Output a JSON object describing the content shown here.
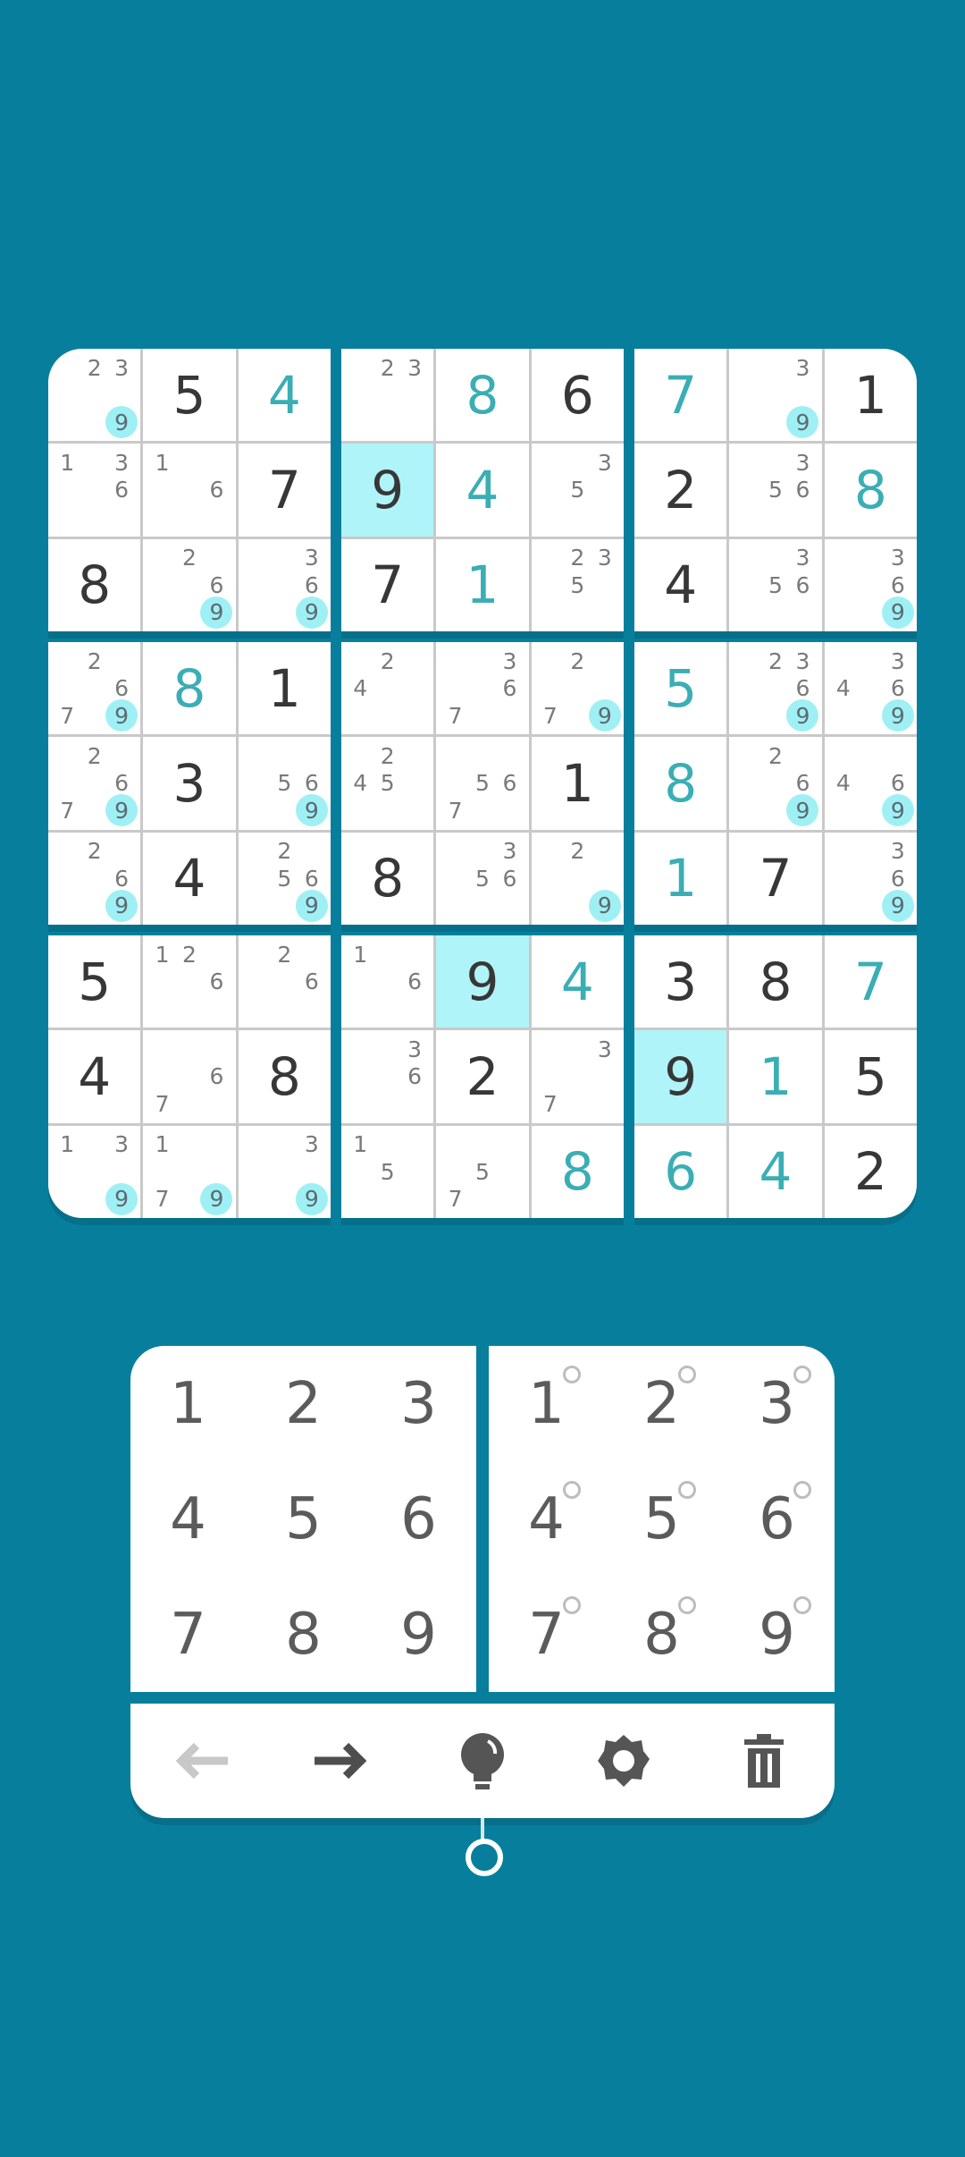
{
  "colors": {
    "background": "#077f9c",
    "highlight": "#aef4f8",
    "user_value": "#3aaeb4",
    "given_value": "#373737"
  },
  "board": [
    [
      {
        "v": "",
        "n": [
          "2",
          "3"
        ],
        "m": [
          "9"
        ]
      },
      {
        "v": "5",
        "t": "g"
      },
      {
        "v": "4",
        "t": "u"
      },
      {
        "v": "",
        "n": [
          "2",
          "3"
        ]
      },
      {
        "v": "8",
        "t": "u"
      },
      {
        "v": "6",
        "t": "g"
      },
      {
        "v": "7",
        "t": "u"
      },
      {
        "v": "",
        "n": [
          "3"
        ],
        "m": [
          "9"
        ]
      },
      {
        "v": "1",
        "t": "g"
      }
    ],
    [
      {
        "v": "",
        "n": [
          "1",
          "3",
          "6"
        ]
      },
      {
        "v": "",
        "n": [
          "1",
          "6"
        ]
      },
      {
        "v": "7",
        "t": "g"
      },
      {
        "v": "9",
        "t": "g",
        "h": true
      },
      {
        "v": "4",
        "t": "u"
      },
      {
        "v": "",
        "n": [
          "3",
          "5"
        ]
      },
      {
        "v": "2",
        "t": "g"
      },
      {
        "v": "",
        "n": [
          "3",
          "5",
          "6"
        ]
      },
      {
        "v": "8",
        "t": "u"
      }
    ],
    [
      {
        "v": "8",
        "t": "g"
      },
      {
        "v": "",
        "n": [
          "2",
          "6"
        ],
        "m": [
          "9"
        ]
      },
      {
        "v": "",
        "n": [
          "3",
          "6"
        ],
        "m": [
          "9"
        ]
      },
      {
        "v": "7",
        "t": "g"
      },
      {
        "v": "1",
        "t": "u"
      },
      {
        "v": "",
        "n": [
          "2",
          "3",
          "5"
        ]
      },
      {
        "v": "4",
        "t": "g"
      },
      {
        "v": "",
        "n": [
          "3",
          "5",
          "6"
        ]
      },
      {
        "v": "",
        "n": [
          "3",
          "6"
        ],
        "m": [
          "9"
        ]
      }
    ],
    [
      {
        "v": "",
        "n": [
          "2",
          "6",
          "7"
        ],
        "m": [
          "9"
        ]
      },
      {
        "v": "8",
        "t": "u"
      },
      {
        "v": "1",
        "t": "g"
      },
      {
        "v": "",
        "n": [
          "2",
          "4"
        ]
      },
      {
        "v": "",
        "n": [
          "3",
          "6",
          "7"
        ]
      },
      {
        "v": "",
        "n": [
          "2",
          "7"
        ],
        "m": [
          "9"
        ]
      },
      {
        "v": "5",
        "t": "u"
      },
      {
        "v": "",
        "n": [
          "2",
          "3",
          "6"
        ],
        "m": [
          "9"
        ]
      },
      {
        "v": "",
        "n": [
          "3",
          "4",
          "6"
        ],
        "m": [
          "9"
        ]
      }
    ],
    [
      {
        "v": "",
        "n": [
          "2",
          "6",
          "7"
        ],
        "m": [
          "9"
        ]
      },
      {
        "v": "3",
        "t": "g"
      },
      {
        "v": "",
        "n": [
          "5",
          "6"
        ],
        "m": [
          "9"
        ]
      },
      {
        "v": "",
        "n": [
          "2",
          "4",
          "5"
        ]
      },
      {
        "v": "",
        "n": [
          "5",
          "6",
          "7"
        ]
      },
      {
        "v": "1",
        "t": "g"
      },
      {
        "v": "8",
        "t": "u"
      },
      {
        "v": "",
        "n": [
          "2",
          "6"
        ],
        "m": [
          "9"
        ]
      },
      {
        "v": "",
        "n": [
          "4",
          "6"
        ],
        "m": [
          "9"
        ]
      }
    ],
    [
      {
        "v": "",
        "n": [
          "2",
          "6"
        ],
        "m": [
          "9"
        ]
      },
      {
        "v": "4",
        "t": "g"
      },
      {
        "v": "",
        "n": [
          "2",
          "5",
          "6"
        ],
        "m": [
          "9"
        ]
      },
      {
        "v": "8",
        "t": "g"
      },
      {
        "v": "",
        "n": [
          "3",
          "5",
          "6"
        ]
      },
      {
        "v": "",
        "n": [
          "2"
        ],
        "m": [
          "9"
        ]
      },
      {
        "v": "1",
        "t": "u"
      },
      {
        "v": "7",
        "t": "g"
      },
      {
        "v": "",
        "n": [
          "3",
          "6"
        ],
        "m": [
          "9"
        ]
      }
    ],
    [
      {
        "v": "5",
        "t": "g"
      },
      {
        "v": "",
        "n": [
          "1",
          "2",
          "6"
        ]
      },
      {
        "v": "",
        "n": [
          "2",
          "6"
        ]
      },
      {
        "v": "",
        "n": [
          "1",
          "6"
        ]
      },
      {
        "v": "9",
        "t": "g",
        "h": true
      },
      {
        "v": "4",
        "t": "u"
      },
      {
        "v": "3",
        "t": "g"
      },
      {
        "v": "8",
        "t": "g"
      },
      {
        "v": "7",
        "t": "u"
      }
    ],
    [
      {
        "v": "4",
        "t": "g"
      },
      {
        "v": "",
        "n": [
          "6",
          "7"
        ]
      },
      {
        "v": "8",
        "t": "g"
      },
      {
        "v": "",
        "n": [
          "3",
          "6"
        ]
      },
      {
        "v": "2",
        "t": "g"
      },
      {
        "v": "",
        "n": [
          "3",
          "7"
        ]
      },
      {
        "v": "9",
        "t": "g",
        "h": true
      },
      {
        "v": "1",
        "t": "u"
      },
      {
        "v": "5",
        "t": "g"
      }
    ],
    [
      {
        "v": "",
        "n": [
          "1",
          "3"
        ],
        "m": [
          "9"
        ]
      },
      {
        "v": "",
        "n": [
          "1",
          "7"
        ],
        "m": [
          "9"
        ]
      },
      {
        "v": "",
        "n": [
          "3"
        ],
        "m": [
          "9"
        ]
      },
      {
        "v": "",
        "n": [
          "1",
          "5"
        ]
      },
      {
        "v": "",
        "n": [
          "5",
          "7"
        ]
      },
      {
        "v": "8",
        "t": "u"
      },
      {
        "v": "6",
        "t": "u"
      },
      {
        "v": "4",
        "t": "u"
      },
      {
        "v": "2",
        "t": "g"
      }
    ]
  ],
  "number_pad": [
    "1",
    "2",
    "3",
    "4",
    "5",
    "6",
    "7",
    "8",
    "9"
  ],
  "pencil_pad": [
    "1",
    "2",
    "3",
    "4",
    "5",
    "6",
    "7",
    "8",
    "9"
  ],
  "toolbar": [
    {
      "name": "undo-icon",
      "enabled": false
    },
    {
      "name": "redo-icon",
      "enabled": true
    },
    {
      "name": "hint-icon",
      "enabled": true
    },
    {
      "name": "settings-icon",
      "enabled": true
    },
    {
      "name": "delete-icon",
      "enabled": true
    }
  ]
}
